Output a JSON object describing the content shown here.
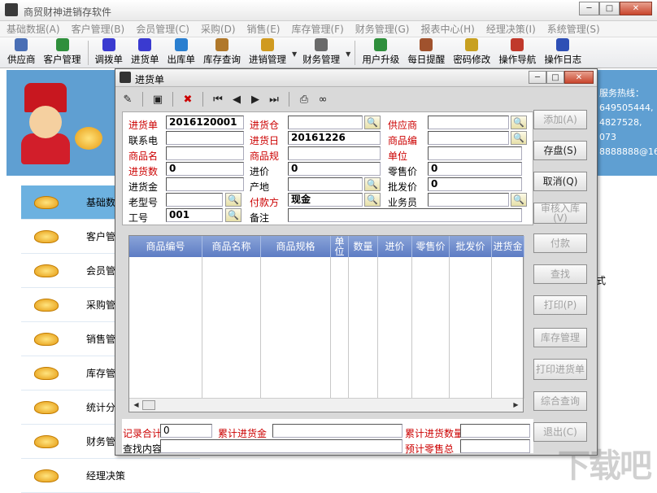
{
  "app": {
    "title": "商贸财神进销存软件"
  },
  "menu": [
    "基础数据(A)",
    "客户管理(B)",
    "会员管理(C)",
    "采购(D)",
    "销售(E)",
    "库存管理(F)",
    "财务管理(G)",
    "报表中心(H)",
    "经理决策(I)",
    "系统管理(S)"
  ],
  "toolbar": [
    {
      "label": "供应商",
      "icon": "supplier-icon",
      "color": "#4a6fb5"
    },
    {
      "label": "客户管理",
      "icon": "globe-icon",
      "color": "#2f8f3c"
    },
    {
      "label": "调拨单",
      "icon": "doc-icon",
      "color": "#3a3ad0"
    },
    {
      "label": "进货单",
      "icon": "doc-icon",
      "color": "#3a3ad0"
    },
    {
      "label": "出库单",
      "icon": "clipboard-icon",
      "color": "#2a7fd0"
    },
    {
      "label": "库存查询",
      "icon": "search-box-icon",
      "color": "#b0782a"
    },
    {
      "label": "进销管理",
      "icon": "folder-icon",
      "color": "#d09a20"
    },
    {
      "label": "财务管理",
      "icon": "cash-icon",
      "color": "#6a6a6a"
    },
    {
      "label": "用户升级",
      "icon": "globe-icon",
      "color": "#2f8f3c"
    },
    {
      "label": "每日提醒",
      "icon": "book-icon",
      "color": "#a0522d"
    },
    {
      "label": "密码修改",
      "icon": "lock-icon",
      "color": "#c8a020"
    },
    {
      "label": "操作导航",
      "icon": "house-icon",
      "color": "#c0392b"
    },
    {
      "label": "操作日志",
      "icon": "save-icon",
      "color": "#2e4fb5"
    }
  ],
  "sidebar": {
    "items": [
      "基础数",
      "客户管",
      "会员管",
      "采购管",
      "销售管",
      "库存管",
      "统计分",
      "财务管",
      "经理决策"
    ]
  },
  "hotline": {
    "label": "服务热线：",
    "lines": [
      "649505444,",
      "4827528, 073",
      "8888888@163"
    ]
  },
  "partial_text": "式",
  "dialog": {
    "title": "进货单",
    "fields": {
      "order_no_label": "进货单",
      "order_no": "2016120001",
      "warehouse_label": "进货仓",
      "warehouse": "",
      "supplier_label": "供应商",
      "supplier": "",
      "contact_label": "联系电",
      "contact": "",
      "date_label": "进货日",
      "date": "20161226",
      "product_code_label": "商品编",
      "product_code": "",
      "product_name_label": "商品名",
      "product_name": "",
      "product_spec_label": "商品规",
      "product_spec": "",
      "unit_label": "单位",
      "unit": "",
      "qty_label": "进货数",
      "qty": "0",
      "price_label": "进价",
      "price": "0",
      "retail_label": "零售价",
      "retail": "0",
      "amount_label": "进货金",
      "amount": "",
      "origin_label": "产地",
      "origin": "",
      "wholesale_label": "批发价",
      "wholesale": "0",
      "old_model_label": "老型号",
      "old_model": "",
      "pay_label": "付款方",
      "pay": "现金",
      "sales_label": "业务员",
      "sales": "",
      "emp_label": "工号",
      "emp": "001",
      "remark_label": "备注",
      "remark": ""
    },
    "grid": {
      "columns": [
        "商品编号",
        "商品名称",
        "商品规格",
        "单\n位",
        "数量",
        "进价",
        "零售价",
        "批发价",
        "进货金"
      ]
    },
    "footer": {
      "count_label": "记录合计",
      "count": "0",
      "total_in_label": "累计进货金",
      "total_in": "",
      "total_qty_label": "累计进货数量",
      "total_qty": "",
      "search_label": "查找内容",
      "search": "",
      "est_sales_label": "预计零售总",
      "est_sales": ""
    },
    "buttons": [
      {
        "label": "添加(A)",
        "enabled": false
      },
      {
        "label": "存盘(S)",
        "enabled": true
      },
      {
        "label": "取消(Q)",
        "enabled": true
      },
      {
        "label": "审核入库(V)",
        "enabled": false
      },
      {
        "label": "付款",
        "enabled": false
      },
      {
        "label": "查找",
        "enabled": false
      },
      {
        "label": "打印(P)",
        "enabled": false
      },
      {
        "label": "库存管理",
        "enabled": false
      },
      {
        "label": "打印进货单",
        "enabled": false
      },
      {
        "label": "综合查询",
        "enabled": false
      },
      {
        "label": "退出(C)",
        "enabled": false
      }
    ]
  },
  "watermark": "下载吧"
}
